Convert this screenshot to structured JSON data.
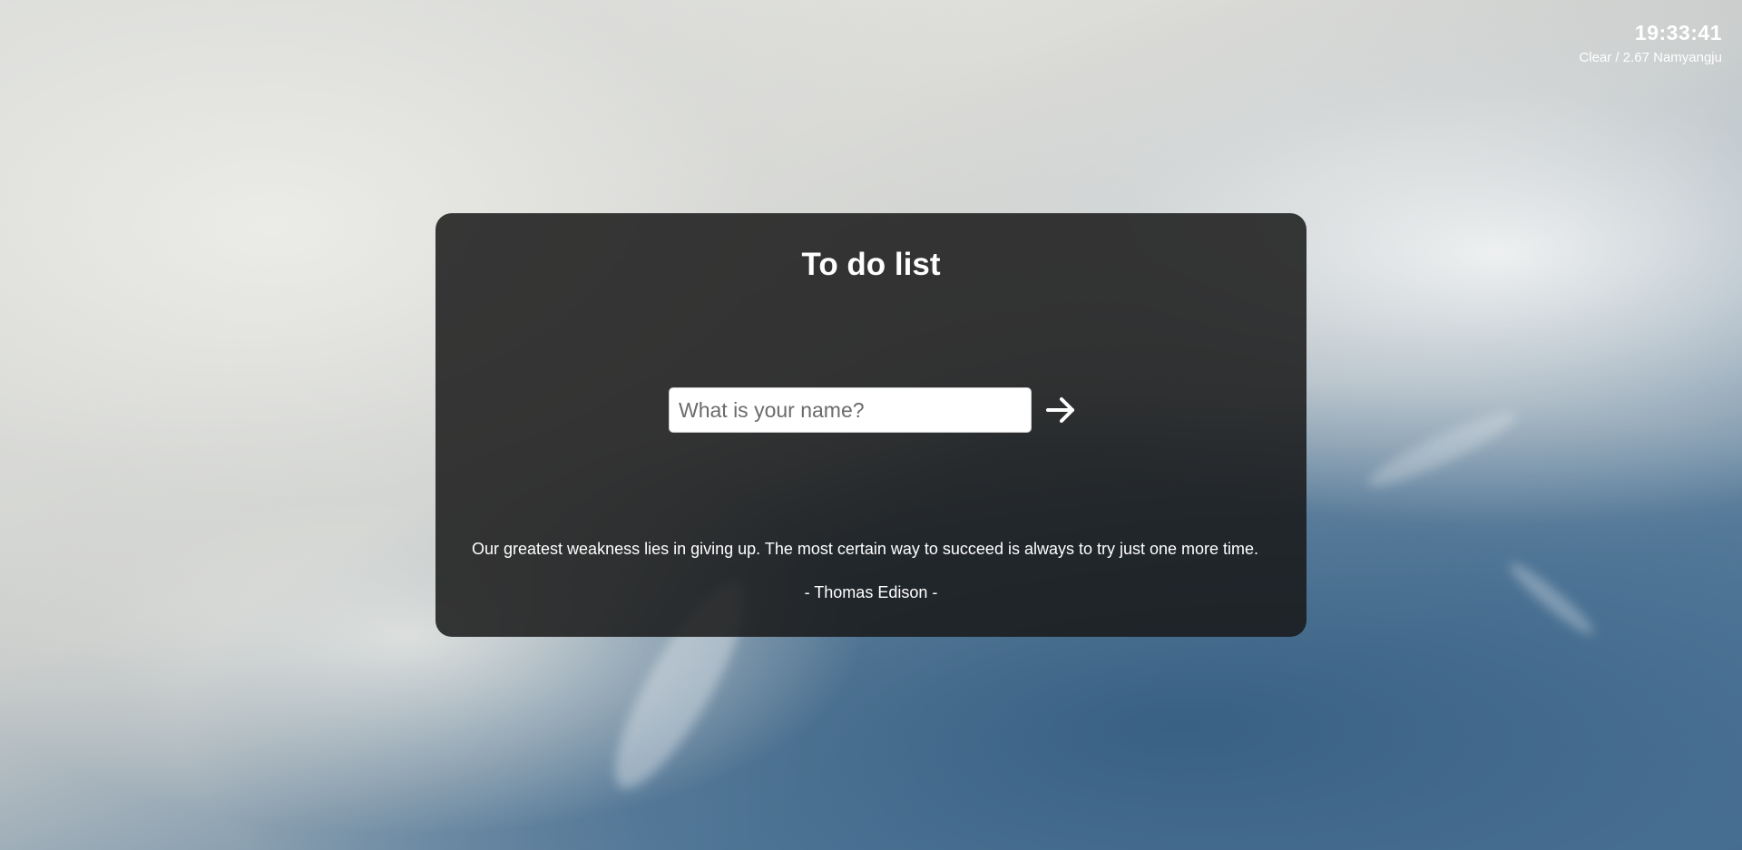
{
  "header": {
    "clock": "19:33:41",
    "weather": "Clear / 2.67 Namyangju"
  },
  "card": {
    "title": "To do list",
    "name_input": {
      "value": "",
      "placeholder": "What is your name?"
    },
    "submit_icon": "arrow-right-icon",
    "quote": {
      "text": "Our greatest weakness lies in giving up. The most certain way to succeed is always to try just one more time.",
      "author": "- Thomas Edison -"
    }
  },
  "colors": {
    "card_background": "#191919",
    "text": "#ffffff",
    "input_background": "#ffffff",
    "placeholder": "#6b6b6b"
  }
}
